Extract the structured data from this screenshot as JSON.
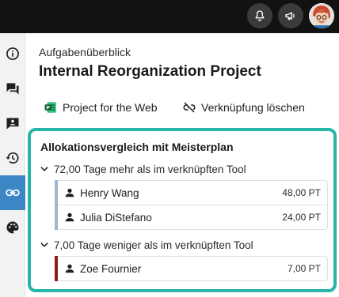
{
  "topbar": {
    "notifications_icon": "bell-icon",
    "announcements_icon": "megaphone-icon",
    "avatar_icon": "user-avatar"
  },
  "sidebar": {
    "items": [
      {
        "icon": "info-icon",
        "active": false
      },
      {
        "icon": "chat-icon",
        "active": false
      },
      {
        "icon": "contact-card-icon",
        "active": false
      },
      {
        "icon": "history-icon",
        "active": false
      },
      {
        "icon": "link-icon",
        "active": true
      },
      {
        "icon": "palette-icon",
        "active": false
      }
    ]
  },
  "header": {
    "overline": "Aufgabenüberblick",
    "title": "Internal Reorganization Project"
  },
  "actions": {
    "project_label": "Project for the Web",
    "unlink_label": "Verknüpfung löschen"
  },
  "comparison": {
    "title": "Allokationsvergleich mit Meisterplan",
    "groups": [
      {
        "label": "72,00 Tage mehr als im verknüpften Tool",
        "color": "#9fb6cc",
        "rows": [
          {
            "name": "Henry Wang",
            "value": "48,00 PT"
          },
          {
            "name": "Julia DiStefano",
            "value": "24,00 PT"
          }
        ]
      },
      {
        "label": "7,00 Tage weniger als im verknüpften Tool",
        "color": "#8c1c1c",
        "rows": [
          {
            "name": "Zoe Fournier",
            "value": "7,00 PT"
          }
        ]
      }
    ]
  },
  "colors": {
    "accent_teal": "#26b5a6",
    "sidebar_active": "#3d86c6",
    "topbar_bg": "#121212"
  }
}
